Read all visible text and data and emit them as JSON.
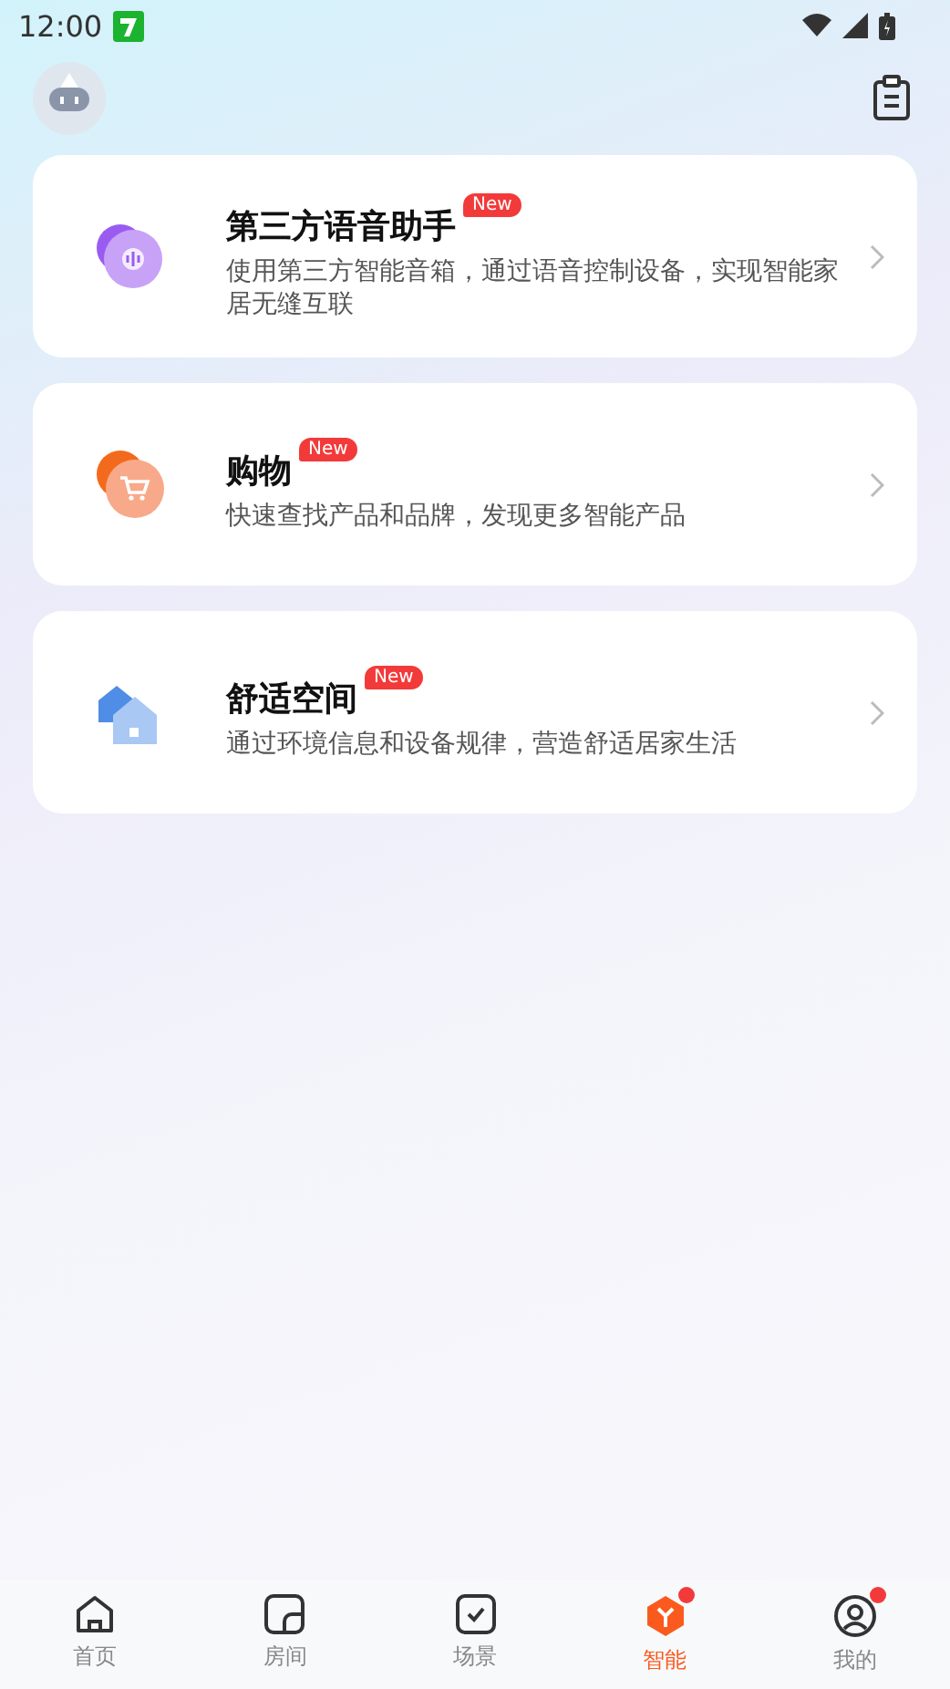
{
  "status_bar": {
    "time": "12:00"
  },
  "cards": [
    {
      "kind": "voice",
      "title": "第三方语音助手",
      "badge": "New",
      "description": "使用第三方智能音箱，通过语音控制设备，实现智能家居无缝互联"
    },
    {
      "kind": "cart",
      "title": "购物",
      "badge": "New",
      "description": "快速查找产品和品牌，发现更多智能产品"
    },
    {
      "kind": "home",
      "title": "舒适空间",
      "badge": "New",
      "description": "通过环境信息和设备规律，营造舒适居家生活"
    }
  ],
  "tabs": [
    {
      "kind": "home",
      "label": "首页",
      "selected": false,
      "dot": false
    },
    {
      "kind": "room",
      "label": "房间",
      "selected": false,
      "dot": false
    },
    {
      "kind": "scene",
      "label": "场景",
      "selected": false,
      "dot": false
    },
    {
      "kind": "smart",
      "label": "智能",
      "selected": true,
      "dot": true
    },
    {
      "kind": "me",
      "label": "我的",
      "selected": false,
      "dot": true
    }
  ]
}
